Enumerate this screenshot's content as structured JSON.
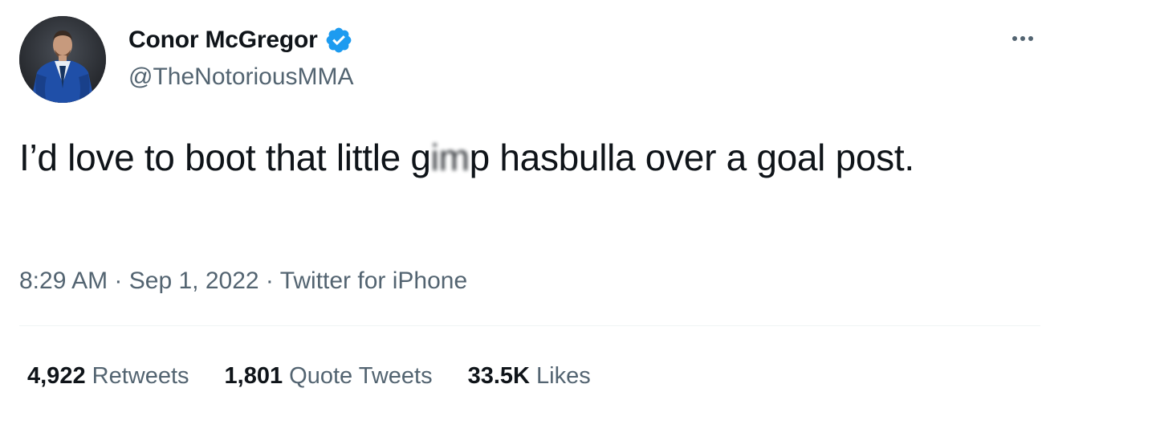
{
  "author": {
    "display_name": "Conor McGregor",
    "handle": "@TheNotoriousMMA",
    "verified": true,
    "verified_color": "#1d9bf0",
    "avatar_icon": "profile-photo"
  },
  "more_icon": "more-horizontal-icon",
  "tweet": {
    "text_before": "I’d love to boot that little g",
    "text_censored": "im",
    "text_after": "p hasbulla over a goal post."
  },
  "meta": {
    "time": "8:29 AM",
    "sep1": " · ",
    "date": "Sep 1, 2022",
    "sep2": " · ",
    "source": "Twitter for iPhone"
  },
  "stats": {
    "retweets": {
      "count": "4,922",
      "label": "Retweets"
    },
    "quote_tweets": {
      "count": "1,801",
      "label": "Quote Tweets"
    },
    "likes": {
      "count": "33.5K",
      "label": "Likes"
    }
  },
  "colors": {
    "text_primary": "#0f1419",
    "text_secondary": "#536471",
    "divider": "#eff3f4",
    "accent": "#1d9bf0"
  }
}
